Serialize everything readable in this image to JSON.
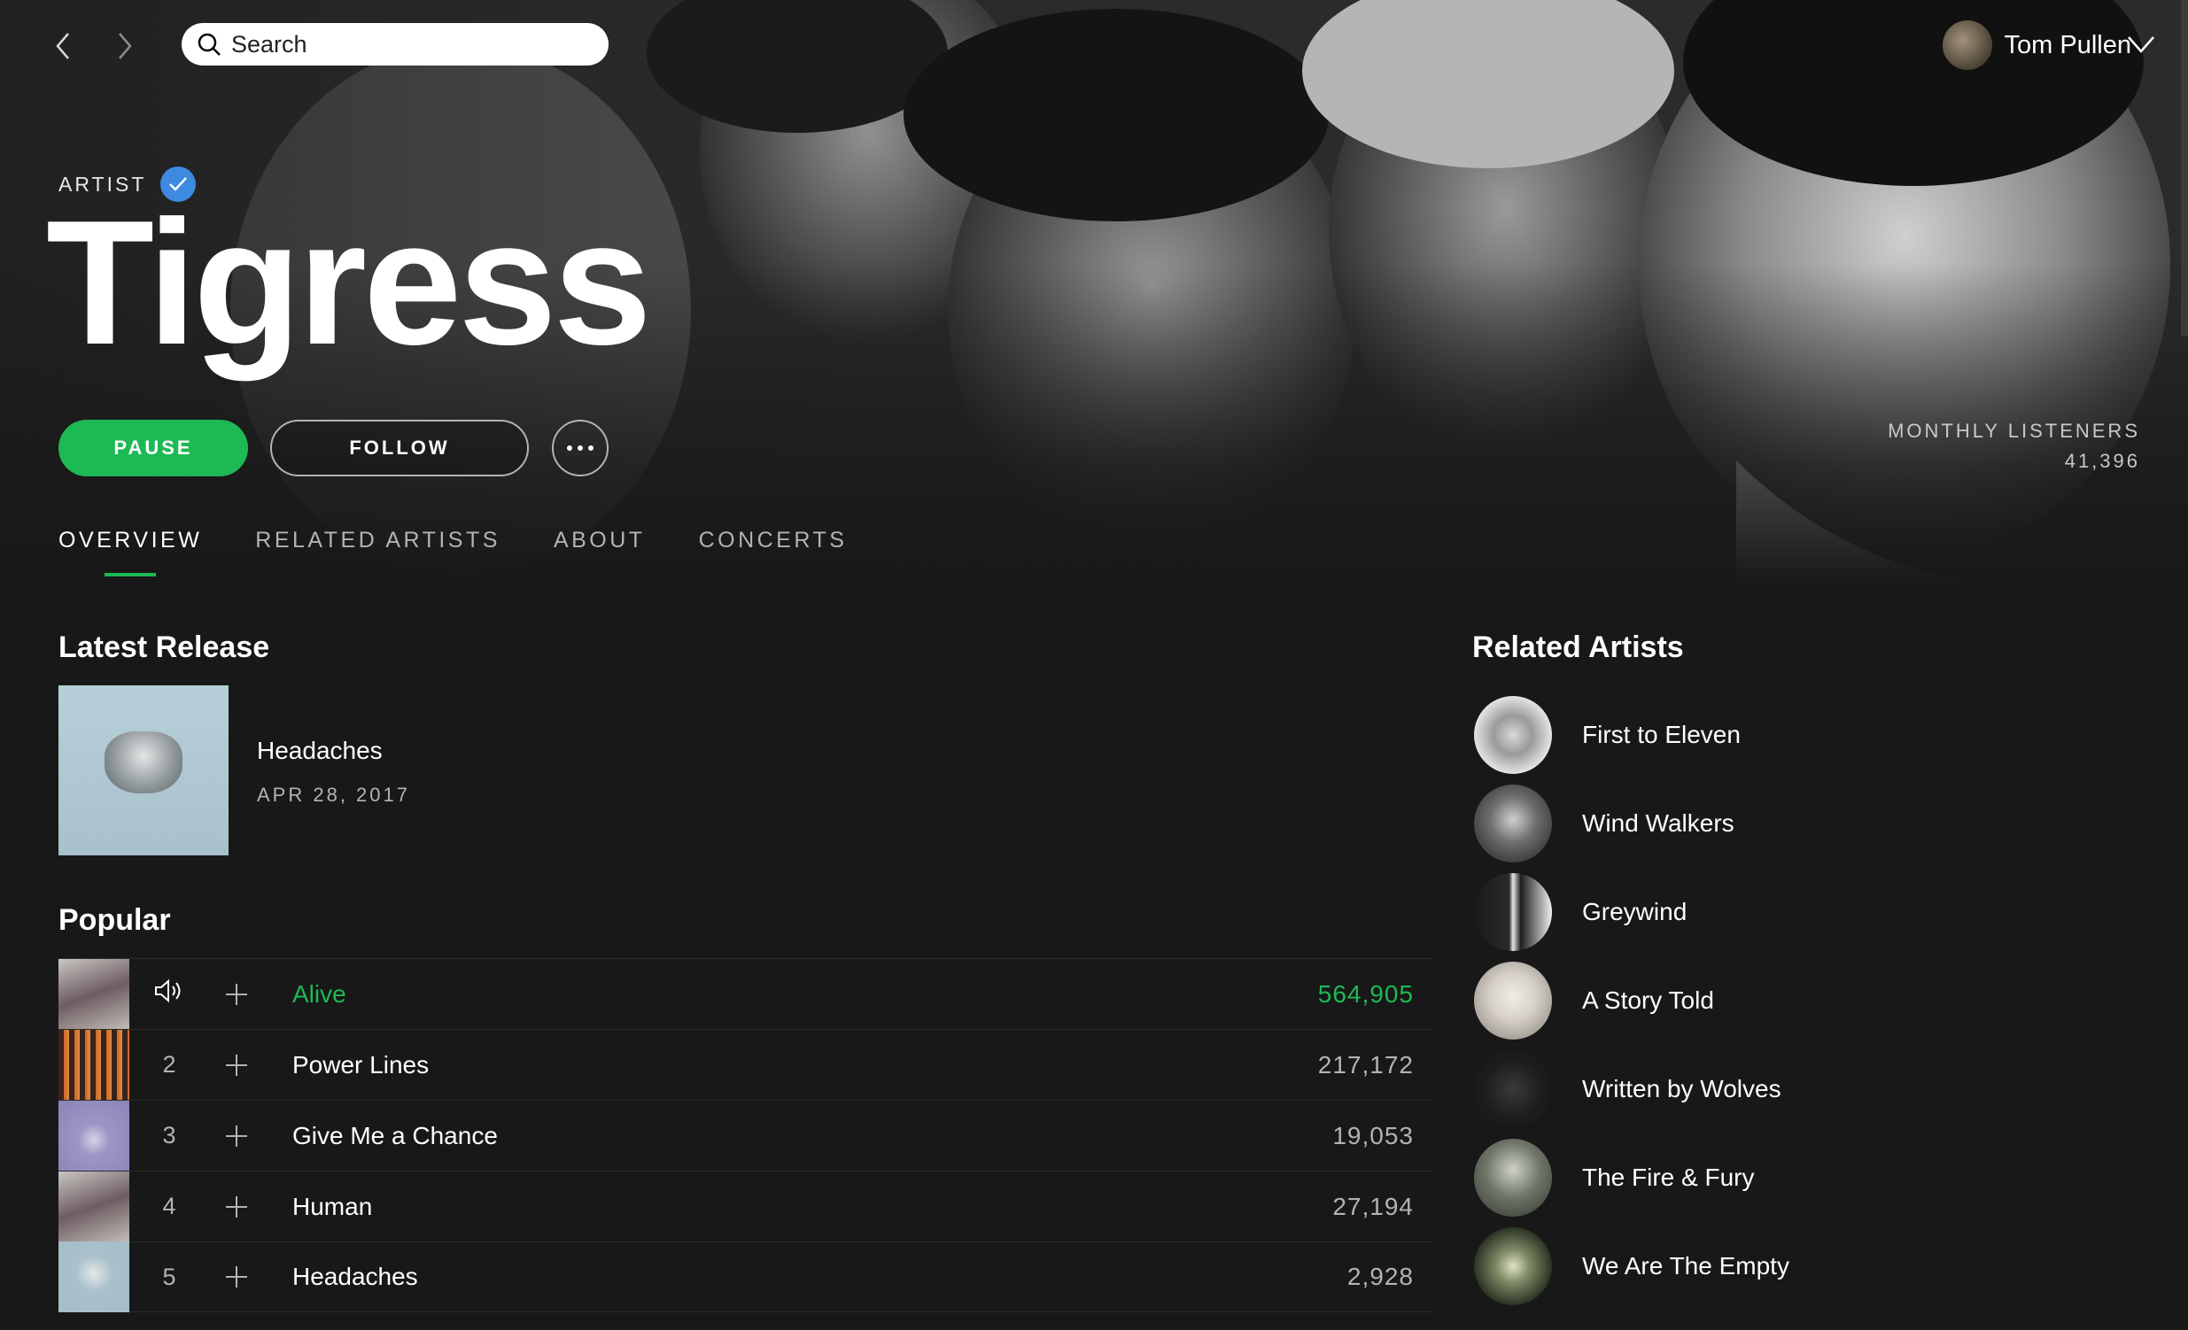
{
  "topbar": {
    "search_placeholder": "Search",
    "user_name": "Tom Pullen"
  },
  "artist": {
    "type_label": "ARTIST",
    "name": "Tigress",
    "verified": true,
    "pause_label": "PAUSE",
    "follow_label": "FOLLOW",
    "monthly_listeners_label": "MONTHLY LISTENERS",
    "monthly_listeners_value": "41,396"
  },
  "tabs": [
    {
      "label": "OVERVIEW",
      "active": true
    },
    {
      "label": "RELATED ARTISTS",
      "active": false
    },
    {
      "label": "ABOUT",
      "active": false
    },
    {
      "label": "CONCERTS",
      "active": false
    }
  ],
  "latest_release": {
    "heading": "Latest Release",
    "title": "Headaches",
    "date": "APR 28, 2017"
  },
  "popular": {
    "heading": "Popular",
    "tracks": [
      {
        "num": "",
        "title": "Alive",
        "plays": "564,905",
        "playing": true
      },
      {
        "num": "2",
        "title": "Power Lines",
        "plays": "217,172",
        "playing": false
      },
      {
        "num": "3",
        "title": "Give Me a Chance",
        "plays": "19,053",
        "playing": false
      },
      {
        "num": "4",
        "title": "Human",
        "plays": "27,194",
        "playing": false
      },
      {
        "num": "5",
        "title": "Headaches",
        "plays": "2,928",
        "playing": false
      }
    ]
  },
  "related_artists": {
    "heading": "Related Artists",
    "items": [
      {
        "name": "First to Eleven"
      },
      {
        "name": "Wind Walkers"
      },
      {
        "name": "Greywind"
      },
      {
        "name": "A Story Told"
      },
      {
        "name": "Written by Wolves"
      },
      {
        "name": "The Fire & Fury"
      },
      {
        "name": "We Are The Empty"
      }
    ]
  },
  "colors": {
    "accent": "#1db954",
    "background": "#181818",
    "verified": "#3d8ae0"
  }
}
